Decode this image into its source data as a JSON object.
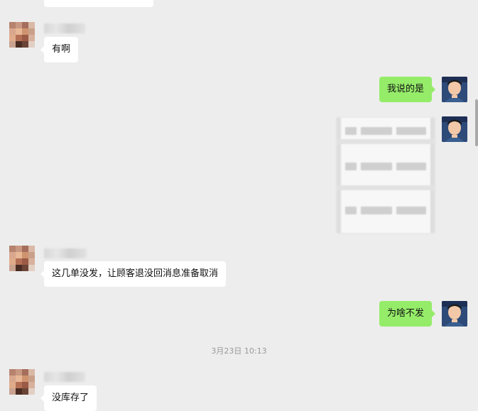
{
  "messages": [
    {
      "text": "有啊"
    },
    {
      "text": "我说的是"
    },
    {
      "text": "这几单没发，让顾客退没回消息准备取消"
    },
    {
      "text": "为啥不发"
    },
    {
      "text": "没库存了"
    }
  ],
  "timestamp": "3月23日 10:13",
  "colors": {
    "background": "#ededed",
    "bubble_self": "#95ec69",
    "bubble_other": "#ffffff",
    "timestamp": "#999999"
  }
}
